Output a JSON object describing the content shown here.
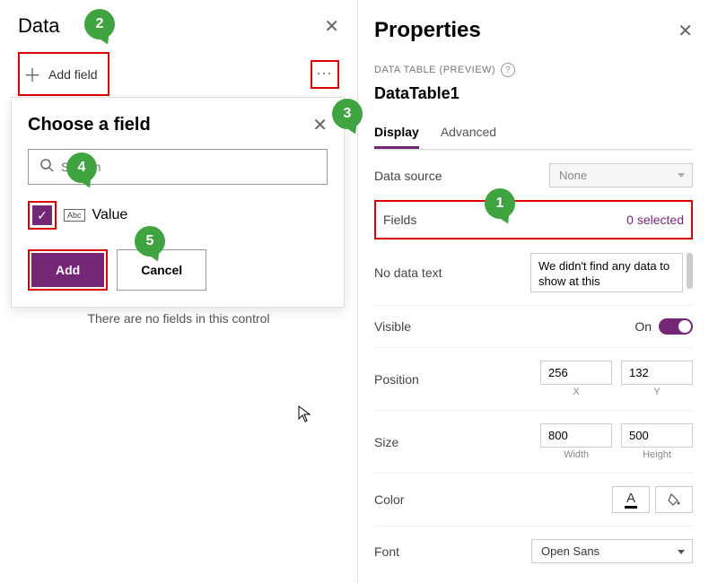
{
  "left": {
    "title": "Data",
    "add_field_label": "Add field",
    "popup": {
      "title": "Choose a field",
      "search_placeholder": "Search",
      "field_icon_text": "Abc",
      "field_name": "Value",
      "add_btn": "Add",
      "cancel_btn": "Cancel"
    },
    "empty_message": "There are no fields in this control"
  },
  "right": {
    "title": "Properties",
    "subtype": "DATA TABLE (PREVIEW)",
    "control_name": "DataTable1",
    "tabs": {
      "display": "Display",
      "advanced": "Advanced"
    },
    "data_source": {
      "label": "Data source",
      "value": "None"
    },
    "fields": {
      "label": "Fields",
      "value": "0 selected"
    },
    "no_data": {
      "label": "No data text",
      "value": "We didn't find any data to show at this"
    },
    "visible": {
      "label": "Visible",
      "state": "On"
    },
    "position": {
      "label": "Position",
      "x": "256",
      "y": "132",
      "xlbl": "X",
      "ylbl": "Y"
    },
    "size": {
      "label": "Size",
      "w": "800",
      "h": "500",
      "wlbl": "Width",
      "hlbl": "Height"
    },
    "color": {
      "label": "Color",
      "letter": "A"
    },
    "font": {
      "label": "Font",
      "value": "Open Sans"
    }
  },
  "callouts": {
    "c1": "1",
    "c2": "2",
    "c3": "3",
    "c4": "4",
    "c5": "5"
  }
}
